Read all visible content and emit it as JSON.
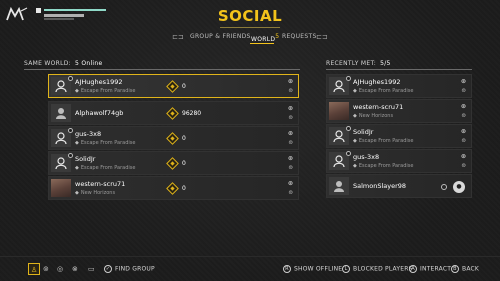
{
  "page": {
    "title": "SOCIAL"
  },
  "tabs": [
    {
      "label": "GROUP & FRIENDS",
      "icon": "controller-left-icon",
      "active": false
    },
    {
      "label": "WORLD",
      "count": "5",
      "active": true
    },
    {
      "label": "REQUESTS",
      "icon": "controller-right-icon",
      "active": false
    }
  ],
  "same_world": {
    "label": "SAME WORLD:",
    "value": "5 Online",
    "players": [
      {
        "name": "AJHughes1992",
        "game": "Escape From Paradise",
        "score": "0",
        "avatar": "default",
        "selected": true
      },
      {
        "name": "Alphawolf74gb",
        "game": "",
        "score": "96280",
        "avatar": "default",
        "selected": false
      },
      {
        "name": "gus-3x8",
        "game": "Escape From Paradise",
        "score": "0",
        "avatar": "default",
        "selected": false
      },
      {
        "name": "SolidJr",
        "game": "Escape From Paradise",
        "score": "0",
        "avatar": "default",
        "selected": false
      },
      {
        "name": "western-scru71",
        "game": "New Horizons",
        "score": "0",
        "avatar": "photo",
        "selected": false
      }
    ]
  },
  "recently_met": {
    "label": "RECENTLY MET:",
    "value": "5/5",
    "players": [
      {
        "name": "AJHughes1992",
        "game": "Escape From Paradise",
        "avatar": "default"
      },
      {
        "name": "western-scru71",
        "game": "New Horizons",
        "avatar": "photo"
      },
      {
        "name": "SolidJr",
        "game": "Escape From Paradise",
        "avatar": "default"
      },
      {
        "name": "gus-3x8",
        "game": "Escape From Paradise",
        "avatar": "default"
      },
      {
        "name": "SalmonSlayer98",
        "game": "",
        "avatar": "default"
      }
    ]
  },
  "bottom": {
    "find_group": "FIND GROUP",
    "hints": [
      {
        "key": "R",
        "label": "SHOW OFFLINE"
      },
      {
        "key": "L",
        "label": "BLOCKED PLAYERS"
      },
      {
        "key": "A",
        "label": "INTERACT"
      },
      {
        "key": "B",
        "label": "BACK"
      }
    ]
  },
  "colors": {
    "accent": "#f3c31b",
    "background": "#1c1c1c"
  }
}
